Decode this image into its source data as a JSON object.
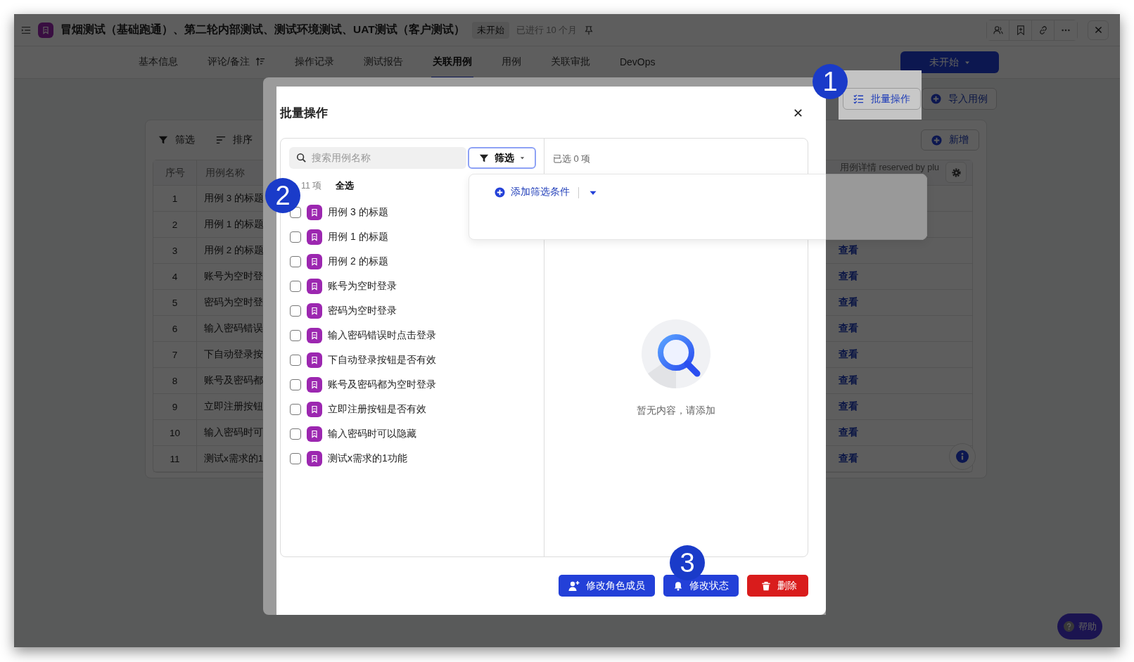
{
  "window": {
    "title": "冒烟测试（基础跑通）、第二轮内部测试、测试环境测试、UAT测试（客户测试）",
    "status_badge": "未开始",
    "elapsed": "已进行 10 个月"
  },
  "tabs": [
    {
      "label": "基本信息",
      "selected": false,
      "kind": "plain"
    },
    {
      "label": "评论/备注",
      "selected": false,
      "kind": "sortable"
    },
    {
      "label": "操作记录",
      "selected": false,
      "kind": "plain"
    },
    {
      "label": "测试报告",
      "selected": false,
      "kind": "plain"
    },
    {
      "label": "关联用例",
      "selected": true,
      "kind": "plain"
    },
    {
      "label": "用例",
      "selected": false,
      "kind": "plain"
    },
    {
      "label": "关联审批",
      "selected": false,
      "kind": "plain"
    },
    {
      "label": "DevOps",
      "selected": false,
      "kind": "plain"
    }
  ],
  "status_button": {
    "label": "未开始"
  },
  "actions": [
    {
      "label": "批量操作",
      "kind": "batch",
      "highlighted": true
    },
    {
      "label": "导入用例",
      "kind": "import",
      "highlighted": false
    }
  ],
  "toolbar": [
    {
      "label": "筛选",
      "kind": "filter"
    },
    {
      "label": "排序",
      "kind": "sort"
    }
  ],
  "add_button": "新增",
  "table": {
    "columns": [
      "序号",
      "用例名称",
      "用例详情 reserved by plu"
    ],
    "rows": [
      {
        "index": "1",
        "name": "用例 3 的标题"
      },
      {
        "index": "2",
        "name": "用例 1 的标题"
      },
      {
        "index": "3",
        "name": "用例 2 的标题",
        "action": "查看"
      },
      {
        "index": "4",
        "name": "账号为空时登",
        "action": "查看"
      },
      {
        "index": "5",
        "name": "密码为空时登",
        "action": "查看"
      },
      {
        "index": "6",
        "name": "输入密码错误",
        "action": "查看"
      },
      {
        "index": "7",
        "name": "下自动登录按",
        "action": "查看"
      },
      {
        "index": "8",
        "name": "账号及密码都",
        "action": "查看"
      },
      {
        "index": "9",
        "name": "立即注册按钮",
        "action": "查看"
      },
      {
        "index": "10",
        "name": "输入密码时可",
        "action": "查看"
      },
      {
        "index": "11",
        "name": "测试x需求的1",
        "action": "查看"
      }
    ]
  },
  "help_button": "帮助",
  "dialog": {
    "title": "批量操作",
    "search": {
      "placeholder": "搜索用例名称"
    },
    "filter_button": "筛选",
    "count": "11 项",
    "select_all": "全选",
    "items": [
      {
        "title": "用例 3 的标题",
        "checked": false
      },
      {
        "title": "用例 1 的标题",
        "checked": false
      },
      {
        "title": "用例 2 的标题",
        "checked": false
      },
      {
        "title": "账号为空时登录",
        "checked": false
      },
      {
        "title": "密码为空时登录",
        "checked": false
      },
      {
        "title": "输入密码错误时点击登录",
        "checked": false
      },
      {
        "title": "下自动登录按钮是否有效",
        "checked": false
      },
      {
        "title": "账号及密码都为空时登录",
        "checked": false
      },
      {
        "title": "立即注册按钮是否有效",
        "checked": false
      },
      {
        "title": "输入密码时可以隐藏",
        "checked": false
      },
      {
        "title": "测试x需求的1功能",
        "checked": false
      }
    ],
    "selected_label": "已选 0 项",
    "empty_text": "暂无内容，请添加",
    "filter_popup": {
      "add_label": "添加筛选条件"
    },
    "buttons": [
      {
        "label": "修改角色成员",
        "kind": "members"
      },
      {
        "label": "修改状态",
        "kind": "status"
      },
      {
        "label": "删除",
        "kind": "delete"
      }
    ]
  },
  "callouts": [
    "1",
    "2",
    "3"
  ]
}
